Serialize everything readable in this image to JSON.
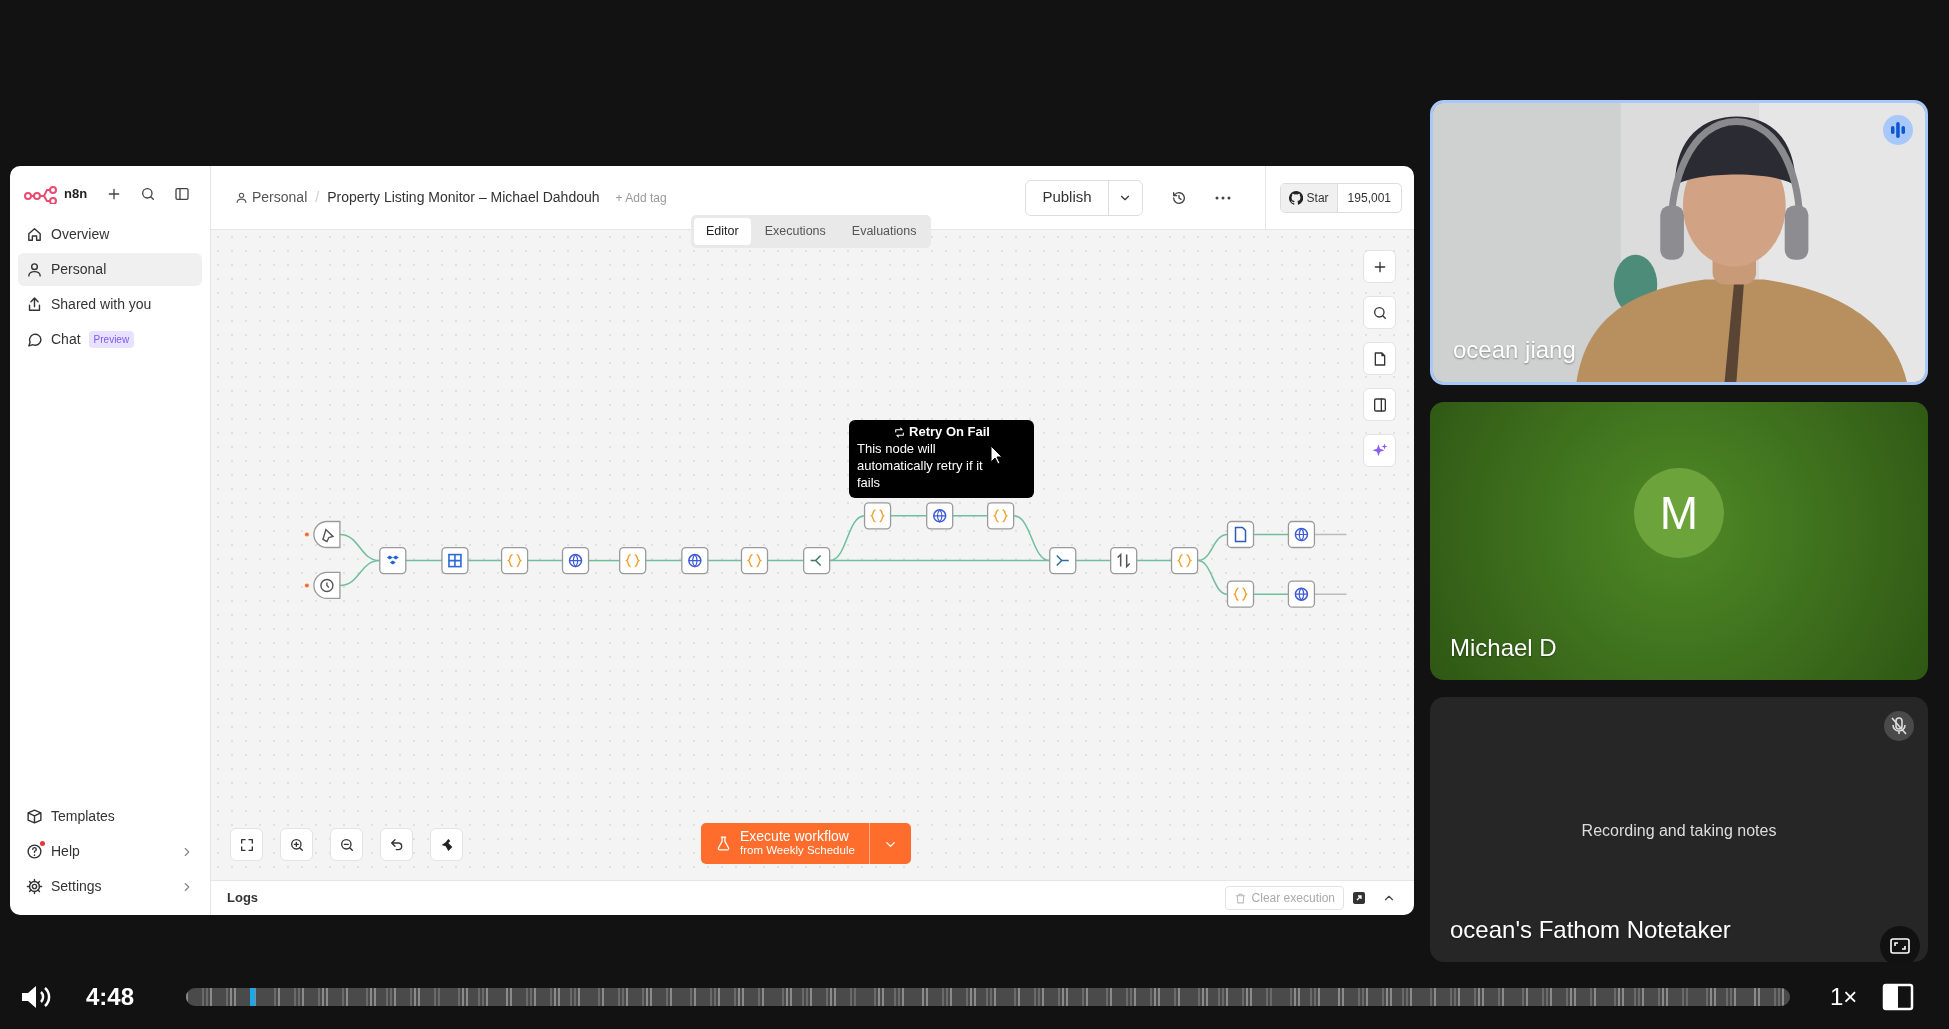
{
  "n8n": {
    "sidebar": {
      "logo": "n8n",
      "items": [
        {
          "label": "Overview",
          "selected": false
        },
        {
          "label": "Personal",
          "selected": true
        },
        {
          "label": "Shared with you",
          "selected": false
        },
        {
          "label": "Chat",
          "badge": "Preview",
          "selected": false
        }
      ],
      "footer_items": [
        {
          "label": "Templates",
          "notification": false,
          "submenu": false
        },
        {
          "label": "Help",
          "notification": true,
          "submenu": true
        },
        {
          "label": "Settings",
          "notification": false,
          "submenu": true
        }
      ]
    },
    "header": {
      "breadcrumb": "Personal",
      "separator": "/",
      "title": "Property Listing Monitor – Michael Dahdouh",
      "add_tag": "+ Add tag",
      "publish": "Publish",
      "github_label": "Star",
      "github_count": "195,001"
    },
    "tabs": [
      {
        "label": "Editor",
        "selected": true
      },
      {
        "label": "Executions",
        "selected": false
      },
      {
        "label": "Evaluations",
        "selected": false
      }
    ],
    "workflow": {
      "nodes": [
        {
          "kind": "manual"
        },
        {
          "kind": "schedule"
        },
        {
          "kind": "dropbox"
        },
        {
          "kind": "table"
        },
        {
          "kind": "code"
        },
        {
          "kind": "http"
        },
        {
          "kind": "code"
        },
        {
          "kind": "http"
        },
        {
          "kind": "code"
        },
        {
          "kind": "switch"
        },
        {
          "kind": "code"
        },
        {
          "kind": "http"
        },
        {
          "kind": "code"
        },
        {
          "kind": "merge"
        },
        {
          "kind": "sort"
        },
        {
          "kind": "code"
        },
        {
          "kind": "file"
        },
        {
          "kind": "http"
        },
        {
          "kind": "code"
        },
        {
          "kind": "http"
        }
      ],
      "tooltip": {
        "title": "Retry On Fail",
        "text": "This node will automatically retry if it fails"
      }
    },
    "execute_button": {
      "label": "Execute workflow",
      "sublabel": "from Weekly Schedule"
    },
    "logs": {
      "title": "Logs",
      "clear": "Clear execution"
    }
  },
  "participants": [
    {
      "kind": "video",
      "name": "ocean jiang",
      "speaking": true
    },
    {
      "kind": "avatar",
      "name": "Michael D",
      "initial": "M"
    },
    {
      "kind": "bot",
      "name": "ocean's Fathom Notetaker",
      "status": "Recording and taking notes",
      "muted": true
    }
  ],
  "player": {
    "time": "4:48",
    "progress": {
      "level": 0.04
    },
    "speed": "1×"
  }
}
